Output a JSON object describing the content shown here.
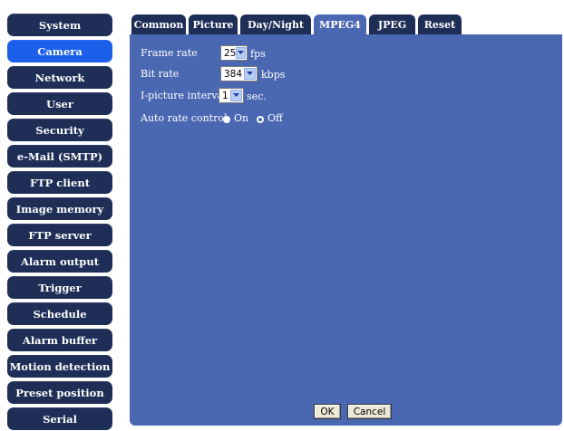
{
  "sidebar": {
    "items": [
      {
        "label": "System",
        "active": false
      },
      {
        "label": "Camera",
        "active": true
      },
      {
        "label": "Network",
        "active": false
      },
      {
        "label": "User",
        "active": false
      },
      {
        "label": "Security",
        "active": false
      },
      {
        "label": "e-Mail (SMTP)",
        "active": false
      },
      {
        "label": "FTP client",
        "active": false
      },
      {
        "label": "Image memory",
        "active": false
      },
      {
        "label": "FTP server",
        "active": false
      },
      {
        "label": "Alarm output",
        "active": false
      },
      {
        "label": "Trigger",
        "active": false
      },
      {
        "label": "Schedule",
        "active": false
      },
      {
        "label": "Alarm buffer",
        "active": false
      },
      {
        "label": "Motion detection",
        "active": false
      },
      {
        "label": "Preset position",
        "active": false
      },
      {
        "label": "Serial",
        "active": false
      }
    ]
  },
  "tabs": [
    {
      "label": "Common",
      "active": false
    },
    {
      "label": "Picture",
      "active": false
    },
    {
      "label": "Day/Night",
      "active": false
    },
    {
      "label": "MPEG4",
      "active": true
    },
    {
      "label": "JPEG",
      "active": false
    },
    {
      "label": "Reset",
      "active": false
    }
  ],
  "form": {
    "frame_rate": {
      "label": "Frame rate",
      "value": "25",
      "unit": "fps"
    },
    "bit_rate": {
      "label": "Bit rate",
      "value": "384",
      "unit": "kbps"
    },
    "i_picture_interval": {
      "label": "I-picture interval",
      "value": "1",
      "unit": "sec."
    },
    "auto_rate_control": {
      "label": "Auto rate control",
      "options": [
        {
          "label": "On",
          "checked": false
        },
        {
          "label": "Off",
          "checked": true
        }
      ]
    }
  },
  "buttons": {
    "ok": "OK",
    "cancel": "Cancel"
  },
  "colors": {
    "panel": "#4a67b2",
    "nav_dark": "#1e2e57",
    "nav_active": "#1b5fea"
  }
}
